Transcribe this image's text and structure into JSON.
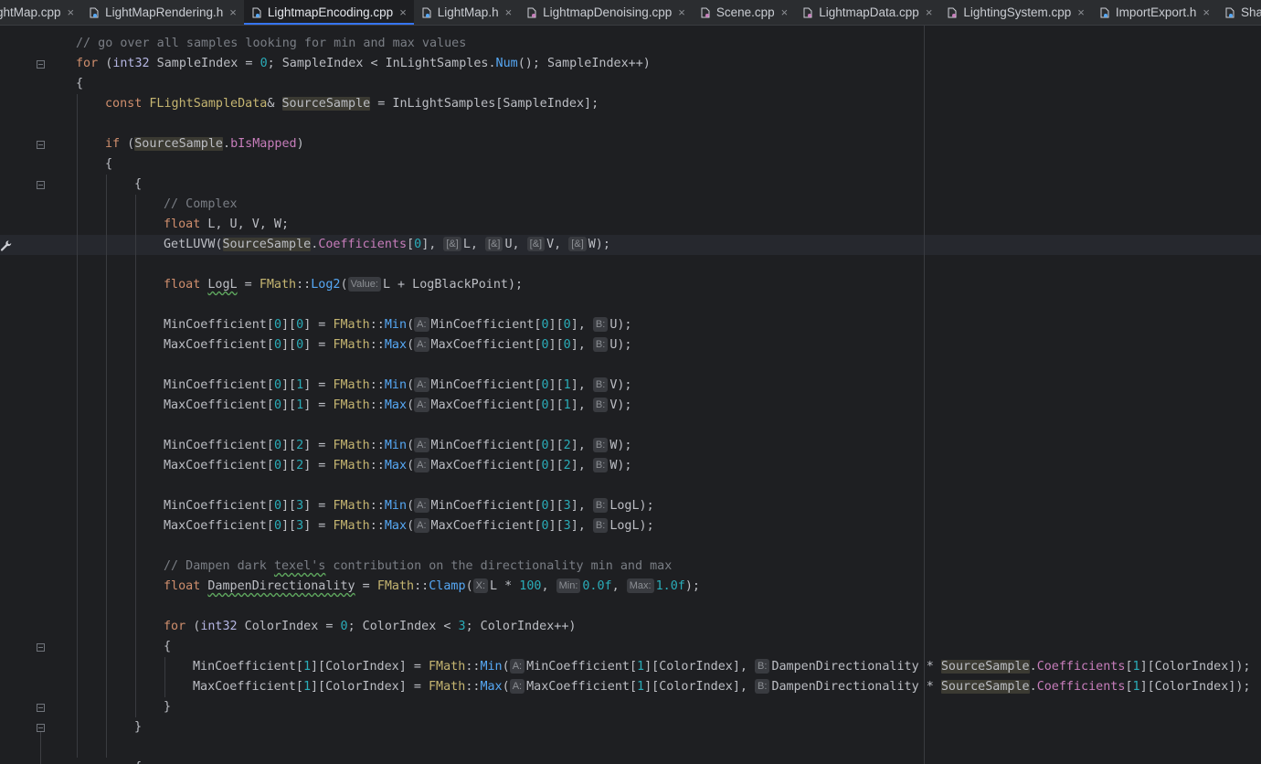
{
  "tabs": [
    {
      "name": "ightMap.cpp",
      "kind": "cpp",
      "active": false
    },
    {
      "name": "LightMapRendering.h",
      "kind": "h",
      "active": false
    },
    {
      "name": "LightmapEncoding.cpp",
      "kind": "h",
      "active": true
    },
    {
      "name": "LightMap.h",
      "kind": "h",
      "active": false
    },
    {
      "name": "LightmapDenoising.cpp",
      "kind": "cpp",
      "active": false
    },
    {
      "name": "Scene.cpp",
      "kind": "cpp",
      "active": false
    },
    {
      "name": "LightmapData.cpp",
      "kind": "cpp",
      "active": false
    },
    {
      "name": "LightingSystem.cpp",
      "kind": "cpp",
      "active": false
    },
    {
      "name": "ImportExport.h",
      "kind": "h",
      "active": false
    },
    {
      "name": "Shade",
      "kind": "h",
      "active": false
    }
  ],
  "close_glyph": "×",
  "caret_line": 11,
  "code_lines": [
    {
      "indent": 0,
      "tokens": [
        [
          "cm",
          "// go over all samples looking for min and max values"
        ]
      ]
    },
    {
      "indent": 0,
      "tokens": [
        [
          "kw",
          "for"
        ],
        [
          "gl",
          " ("
        ],
        [
          "ty",
          "int32"
        ],
        [
          "gl",
          " SampleIndex = "
        ],
        [
          "num",
          "0"
        ],
        [
          "gl",
          "; SampleIndex < InLightSamples."
        ],
        [
          "fn",
          "Num"
        ],
        [
          "gl",
          "(); SampleIndex++)"
        ]
      ]
    },
    {
      "indent": 0,
      "tokens": [
        [
          "gl",
          "{"
        ]
      ]
    },
    {
      "indent": 1,
      "tokens": [
        [
          "kw",
          "const"
        ],
        [
          "gl",
          " "
        ],
        [
          "cls",
          "FLightSampleData"
        ],
        [
          "gl",
          "& "
        ],
        [
          "hl",
          "SourceSample"
        ],
        [
          "gl",
          " = InLightSamples[SampleIndex];"
        ]
      ]
    },
    {
      "indent": 1,
      "tokens": []
    },
    {
      "indent": 1,
      "tokens": [
        [
          "kw",
          "if"
        ],
        [
          "gl",
          " ("
        ],
        [
          "hl",
          "SourceSample"
        ],
        [
          "gl",
          "."
        ],
        [
          "fld",
          "bIsMapped"
        ],
        [
          "gl",
          ")"
        ]
      ]
    },
    {
      "indent": 1,
      "tokens": [
        [
          "gl",
          "{"
        ]
      ]
    },
    {
      "indent": 2,
      "tokens": [
        [
          "gl",
          "{"
        ]
      ]
    },
    {
      "indent": 3,
      "tokens": [
        [
          "cm",
          "// Complex"
        ]
      ]
    },
    {
      "indent": 3,
      "tokens": [
        [
          "kw",
          "float"
        ],
        [
          "gl",
          " L, U, V, W;"
        ]
      ]
    },
    {
      "indent": 3,
      "tokens": [
        [
          "fnc",
          "GetLUVW"
        ],
        [
          "gl",
          "("
        ],
        [
          "hl",
          "SourceSample"
        ],
        [
          "gl",
          "."
        ],
        [
          "fld",
          "Coefficients"
        ],
        [
          "gl",
          "["
        ],
        [
          "num",
          "0"
        ],
        [
          "gl",
          "], "
        ],
        [
          "hint",
          "[&]"
        ],
        [
          "gl",
          "L, "
        ],
        [
          "hint",
          "[&]"
        ],
        [
          "gl",
          "U, "
        ],
        [
          "hint",
          "[&]"
        ],
        [
          "gl",
          "V, "
        ],
        [
          "hint",
          "[&]"
        ],
        [
          "gl",
          "W);"
        ]
      ]
    },
    {
      "indent": 3,
      "tokens": []
    },
    {
      "indent": 3,
      "tokens": [
        [
          "kw",
          "float"
        ],
        [
          "gl",
          " "
        ],
        [
          "typo",
          "LogL"
        ],
        [
          "gl",
          " = "
        ],
        [
          "ns",
          "FMath"
        ],
        [
          "gl",
          "::"
        ],
        [
          "fn",
          "Log2"
        ],
        [
          "gl",
          "("
        ],
        [
          "hint",
          "Value:"
        ],
        [
          "gl",
          "L + LogBlackPoint);"
        ]
      ]
    },
    {
      "indent": 3,
      "tokens": []
    },
    {
      "indent": 3,
      "tokens": [
        [
          "gl",
          "MinCoefficient["
        ],
        [
          "num",
          "0"
        ],
        [
          "gl",
          "]["
        ],
        [
          "num",
          "0"
        ],
        [
          "gl",
          "] = "
        ],
        [
          "ns",
          "FMath"
        ],
        [
          "gl",
          "::"
        ],
        [
          "fn",
          "Min"
        ],
        [
          "gl",
          "("
        ],
        [
          "hint",
          "A:"
        ],
        [
          "gl",
          "MinCoefficient["
        ],
        [
          "num",
          "0"
        ],
        [
          "gl",
          "]["
        ],
        [
          "num",
          "0"
        ],
        [
          "gl",
          "], "
        ],
        [
          "hint",
          "B:"
        ],
        [
          "gl",
          "U);"
        ]
      ]
    },
    {
      "indent": 3,
      "tokens": [
        [
          "gl",
          "MaxCoefficient["
        ],
        [
          "num",
          "0"
        ],
        [
          "gl",
          "]["
        ],
        [
          "num",
          "0"
        ],
        [
          "gl",
          "] = "
        ],
        [
          "ns",
          "FMath"
        ],
        [
          "gl",
          "::"
        ],
        [
          "fn",
          "Max"
        ],
        [
          "gl",
          "("
        ],
        [
          "hint",
          "A:"
        ],
        [
          "gl",
          "MaxCoefficient["
        ],
        [
          "num",
          "0"
        ],
        [
          "gl",
          "]["
        ],
        [
          "num",
          "0"
        ],
        [
          "gl",
          "], "
        ],
        [
          "hint",
          "B:"
        ],
        [
          "gl",
          "U);"
        ]
      ]
    },
    {
      "indent": 3,
      "tokens": []
    },
    {
      "indent": 3,
      "tokens": [
        [
          "gl",
          "MinCoefficient["
        ],
        [
          "num",
          "0"
        ],
        [
          "gl",
          "]["
        ],
        [
          "num",
          "1"
        ],
        [
          "gl",
          "] = "
        ],
        [
          "ns",
          "FMath"
        ],
        [
          "gl",
          "::"
        ],
        [
          "fn",
          "Min"
        ],
        [
          "gl",
          "("
        ],
        [
          "hint",
          "A:"
        ],
        [
          "gl",
          "MinCoefficient["
        ],
        [
          "num",
          "0"
        ],
        [
          "gl",
          "]["
        ],
        [
          "num",
          "1"
        ],
        [
          "gl",
          "], "
        ],
        [
          "hint",
          "B:"
        ],
        [
          "gl",
          "V);"
        ]
      ]
    },
    {
      "indent": 3,
      "tokens": [
        [
          "gl",
          "MaxCoefficient["
        ],
        [
          "num",
          "0"
        ],
        [
          "gl",
          "]["
        ],
        [
          "num",
          "1"
        ],
        [
          "gl",
          "] = "
        ],
        [
          "ns",
          "FMath"
        ],
        [
          "gl",
          "::"
        ],
        [
          "fn",
          "Max"
        ],
        [
          "gl",
          "("
        ],
        [
          "hint",
          "A:"
        ],
        [
          "gl",
          "MaxCoefficient["
        ],
        [
          "num",
          "0"
        ],
        [
          "gl",
          "]["
        ],
        [
          "num",
          "1"
        ],
        [
          "gl",
          "], "
        ],
        [
          "hint",
          "B:"
        ],
        [
          "gl",
          "V);"
        ]
      ]
    },
    {
      "indent": 3,
      "tokens": []
    },
    {
      "indent": 3,
      "tokens": [
        [
          "gl",
          "MinCoefficient["
        ],
        [
          "num",
          "0"
        ],
        [
          "gl",
          "]["
        ],
        [
          "num",
          "2"
        ],
        [
          "gl",
          "] = "
        ],
        [
          "ns",
          "FMath"
        ],
        [
          "gl",
          "::"
        ],
        [
          "fn",
          "Min"
        ],
        [
          "gl",
          "("
        ],
        [
          "hint",
          "A:"
        ],
        [
          "gl",
          "MinCoefficient["
        ],
        [
          "num",
          "0"
        ],
        [
          "gl",
          "]["
        ],
        [
          "num",
          "2"
        ],
        [
          "gl",
          "], "
        ],
        [
          "hint",
          "B:"
        ],
        [
          "gl",
          "W);"
        ]
      ]
    },
    {
      "indent": 3,
      "tokens": [
        [
          "gl",
          "MaxCoefficient["
        ],
        [
          "num",
          "0"
        ],
        [
          "gl",
          "]["
        ],
        [
          "num",
          "2"
        ],
        [
          "gl",
          "] = "
        ],
        [
          "ns",
          "FMath"
        ],
        [
          "gl",
          "::"
        ],
        [
          "fn",
          "Max"
        ],
        [
          "gl",
          "("
        ],
        [
          "hint",
          "A:"
        ],
        [
          "gl",
          "MaxCoefficient["
        ],
        [
          "num",
          "0"
        ],
        [
          "gl",
          "]["
        ],
        [
          "num",
          "2"
        ],
        [
          "gl",
          "], "
        ],
        [
          "hint",
          "B:"
        ],
        [
          "gl",
          "W);"
        ]
      ]
    },
    {
      "indent": 3,
      "tokens": []
    },
    {
      "indent": 3,
      "tokens": [
        [
          "gl",
          "MinCoefficient["
        ],
        [
          "num",
          "0"
        ],
        [
          "gl",
          "]["
        ],
        [
          "num",
          "3"
        ],
        [
          "gl",
          "] = "
        ],
        [
          "ns",
          "FMath"
        ],
        [
          "gl",
          "::"
        ],
        [
          "fn",
          "Min"
        ],
        [
          "gl",
          "("
        ],
        [
          "hint",
          "A:"
        ],
        [
          "gl",
          "MinCoefficient["
        ],
        [
          "num",
          "0"
        ],
        [
          "gl",
          "]["
        ],
        [
          "num",
          "3"
        ],
        [
          "gl",
          "], "
        ],
        [
          "hint",
          "B:"
        ],
        [
          "gl",
          "LogL);"
        ]
      ]
    },
    {
      "indent": 3,
      "tokens": [
        [
          "gl",
          "MaxCoefficient["
        ],
        [
          "num",
          "0"
        ],
        [
          "gl",
          "]["
        ],
        [
          "num",
          "3"
        ],
        [
          "gl",
          "] = "
        ],
        [
          "ns",
          "FMath"
        ],
        [
          "gl",
          "::"
        ],
        [
          "fn",
          "Max"
        ],
        [
          "gl",
          "("
        ],
        [
          "hint",
          "A:"
        ],
        [
          "gl",
          "MaxCoefficient["
        ],
        [
          "num",
          "0"
        ],
        [
          "gl",
          "]["
        ],
        [
          "num",
          "3"
        ],
        [
          "gl",
          "], "
        ],
        [
          "hint",
          "B:"
        ],
        [
          "gl",
          "LogL);"
        ]
      ]
    },
    {
      "indent": 3,
      "tokens": []
    },
    {
      "indent": 3,
      "tokens": [
        [
          "cm",
          "// Dampen dark "
        ],
        [
          "cmtypo",
          "texel's"
        ],
        [
          "cm",
          " contribution on the directionality min and max"
        ]
      ]
    },
    {
      "indent": 3,
      "tokens": [
        [
          "kw",
          "float"
        ],
        [
          "gl",
          " "
        ],
        [
          "typo",
          "DampenDirectionality"
        ],
        [
          "gl",
          " = "
        ],
        [
          "ns",
          "FMath"
        ],
        [
          "gl",
          "::"
        ],
        [
          "fn",
          "Clamp"
        ],
        [
          "gl",
          "("
        ],
        [
          "hint",
          "X:"
        ],
        [
          "gl",
          "L * "
        ],
        [
          "num",
          "100"
        ],
        [
          "gl",
          ", "
        ],
        [
          "hint",
          "Min:"
        ],
        [
          "num",
          "0.0f"
        ],
        [
          "gl",
          ", "
        ],
        [
          "hint",
          "Max:"
        ],
        [
          "num",
          "1.0f"
        ],
        [
          "gl",
          ");"
        ]
      ]
    },
    {
      "indent": 3,
      "tokens": []
    },
    {
      "indent": 3,
      "tokens": [
        [
          "kw",
          "for"
        ],
        [
          "gl",
          " ("
        ],
        [
          "ty",
          "int32"
        ],
        [
          "gl",
          " ColorIndex = "
        ],
        [
          "num",
          "0"
        ],
        [
          "gl",
          "; ColorIndex < "
        ],
        [
          "num",
          "3"
        ],
        [
          "gl",
          "; ColorIndex++)"
        ]
      ]
    },
    {
      "indent": 3,
      "tokens": [
        [
          "gl",
          "{"
        ]
      ]
    },
    {
      "indent": 4,
      "tokens": [
        [
          "gl",
          "MinCoefficient["
        ],
        [
          "num",
          "1"
        ],
        [
          "gl",
          "][ColorIndex] = "
        ],
        [
          "ns",
          "FMath"
        ],
        [
          "gl",
          "::"
        ],
        [
          "fn",
          "Min"
        ],
        [
          "gl",
          "("
        ],
        [
          "hint",
          "A:"
        ],
        [
          "gl",
          "MinCoefficient["
        ],
        [
          "num",
          "1"
        ],
        [
          "gl",
          "][ColorIndex], "
        ],
        [
          "hint",
          "B:"
        ],
        [
          "gl",
          "DampenDirectionality * "
        ],
        [
          "hl",
          "SourceSample"
        ],
        [
          "gl",
          "."
        ],
        [
          "fld",
          "Coefficients"
        ],
        [
          "gl",
          "["
        ],
        [
          "num",
          "1"
        ],
        [
          "gl",
          "][ColorIndex]);"
        ]
      ]
    },
    {
      "indent": 4,
      "tokens": [
        [
          "gl",
          "MaxCoefficient["
        ],
        [
          "num",
          "1"
        ],
        [
          "gl",
          "][ColorIndex] = "
        ],
        [
          "ns",
          "FMath"
        ],
        [
          "gl",
          "::"
        ],
        [
          "fn",
          "Max"
        ],
        [
          "gl",
          "("
        ],
        [
          "hint",
          "A:"
        ],
        [
          "gl",
          "MaxCoefficient["
        ],
        [
          "num",
          "1"
        ],
        [
          "gl",
          "][ColorIndex], "
        ],
        [
          "hint",
          "B:"
        ],
        [
          "gl",
          "DampenDirectionality * "
        ],
        [
          "hl",
          "SourceSample"
        ],
        [
          "gl",
          "."
        ],
        [
          "fld",
          "Coefficients"
        ],
        [
          "gl",
          "["
        ],
        [
          "num",
          "1"
        ],
        [
          "gl",
          "][ColorIndex]);"
        ]
      ]
    },
    {
      "indent": 3,
      "tokens": [
        [
          "gl",
          "}"
        ]
      ]
    },
    {
      "indent": 2,
      "tokens": [
        [
          "gl",
          "}"
        ]
      ]
    },
    {
      "indent": 2,
      "tokens": []
    },
    {
      "indent": 2,
      "tokens": [
        [
          "gl",
          "{"
        ]
      ]
    }
  ]
}
